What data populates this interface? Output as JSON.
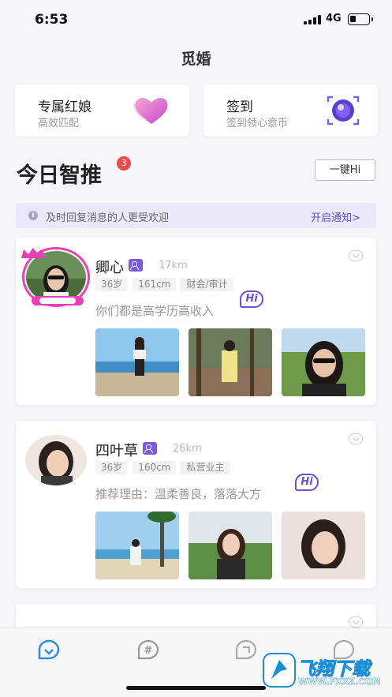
{
  "status_bar": {
    "time": "6:53",
    "network": "4G",
    "battery_level": 0.35
  },
  "app_title": "觅婚",
  "features": [
    {
      "title": "专属红娘",
      "subtitle": "高效匹配",
      "icon": "heart-icon"
    },
    {
      "title": "签到",
      "subtitle": "签到领心意币",
      "icon": "eye-camera-icon"
    }
  ],
  "section": {
    "title": "今日智推",
    "badge": "3",
    "hi_all_label": "一键Hi"
  },
  "notice": {
    "text": "及时回复消息的人更受欢迎",
    "action": "开启通知>"
  },
  "profiles": [
    {
      "name": "卿心",
      "distance": "17km",
      "tags": [
        "36岁",
        "161cm",
        "财会/审计"
      ],
      "reason": "你们都是高学历高收入",
      "hi_label": "Hi"
    },
    {
      "name": "四叶草",
      "distance": "26km",
      "tags": [
        "36岁",
        "160cm",
        "私营业主"
      ],
      "reason": "推荐理由：温柔善良，落落大方",
      "hi_label": "Hi"
    }
  ],
  "tabbar": [
    "home-tab-icon",
    "topic-tab-icon",
    "message-tab-icon",
    "profile-tab-icon"
  ],
  "watermark": {
    "text": "飞翔下载",
    "url": "WWW.FXXZ.COM"
  },
  "colors": {
    "accent": "#6b4fd6",
    "badge": "#ef4a4a",
    "notice_bg": "#ebe8fb",
    "avatar_ring": "#ea3fb7"
  }
}
